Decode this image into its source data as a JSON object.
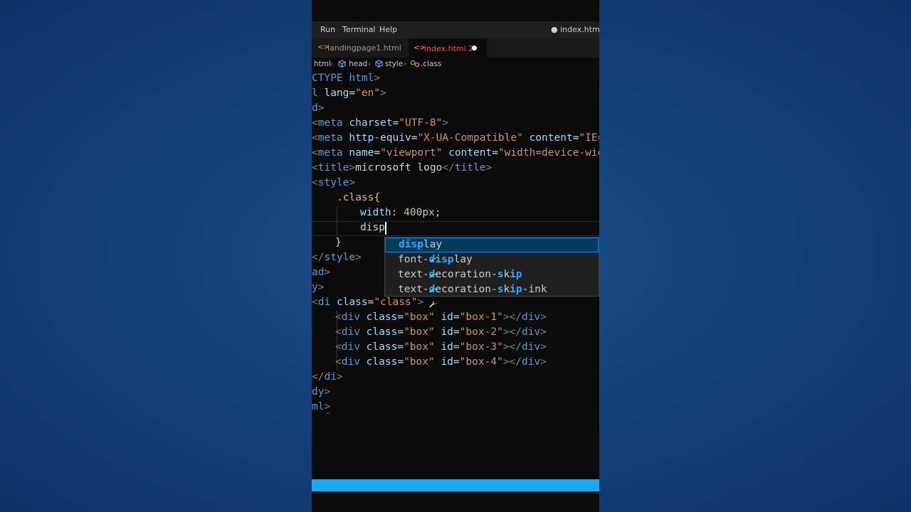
{
  "menu": {
    "run": "Run",
    "terminal": "Terminal",
    "help": "Help",
    "window_title": "● index.html - in"
  },
  "tabs": [
    {
      "icon": "<>",
      "label": "landingpage1.html"
    },
    {
      "icon": "<>",
      "label": "index.html 2"
    }
  ],
  "breadcrumb": {
    "html": "html",
    "head": "head",
    "style": "style",
    "class": ".class",
    "sep": "›"
  },
  "code": {
    "l1": {
      "t": "CTYPE html",
      "p": ">"
    },
    "l2": {
      "t": "l",
      "a": "lang",
      "eq": "=",
      "s": "\"en\"",
      "p": ">"
    },
    "l3": {
      "t": "d",
      "p": ">"
    },
    "l4": {
      "p1": "<",
      "t": "meta",
      "a": "charset",
      "eq": "=",
      "s": "\"UTF-8\"",
      "p2": ">"
    },
    "l5": {
      "p1": "<",
      "t": "meta",
      "a1": "http-equiv",
      "eq1": "=",
      "s1": "\"X-UA-Compatible\"",
      "a2": "content",
      "eq2": "=",
      "s2": "\"IE="
    },
    "l6": {
      "p1": "<",
      "t": "meta",
      "a1": "name",
      "eq1": "=",
      "s1": "\"viewport\"",
      "a2": "content",
      "eq2": "=",
      "s2": "\"width=device-wid"
    },
    "l7": {
      "p1": "<",
      "t1": "title",
      "p2": ">",
      "txt": "microsoft logo",
      "p3": "</",
      "t2": "title",
      "p4": ">"
    },
    "l8": {
      "p1": "<",
      "t": "style",
      "p2": ">"
    },
    "l9": {
      "sel": ".class",
      "br": "{"
    },
    "l10": {
      "prop": "width",
      "colon": ": ",
      "num": "400px",
      "semi": ";"
    },
    "l11": {
      "txt": "disp"
    },
    "l12": {
      "br": "}"
    },
    "l13": {
      "p1": "</",
      "t": "style",
      "p2": ">"
    },
    "l14": {
      "t": "ad",
      "p": ">"
    },
    "l15": {
      "t": "y",
      "p": ">"
    },
    "l16": {
      "p1": "<",
      "t": "di",
      "a": "class",
      "eq": "=",
      "s": "\"class\"",
      "p2": ">"
    },
    "boxes": [
      {
        "s1": "\"box\"",
        "s2": "\"box-1\""
      },
      {
        "s1": "\"box\"",
        "s2": "\"box-2\""
      },
      {
        "s1": "\"box\"",
        "s2": "\"box-3\""
      },
      {
        "s1": "\"box\"",
        "s2": "\"box-4\""
      }
    ],
    "box_tag": "div",
    "box_a1": "class",
    "box_a2": "id",
    "box_eq": "=",
    "box_open": "<",
    "box_gt": ">",
    "box_close": "</",
    "l21": {
      "p1": "</",
      "t": "di",
      "p2": ">"
    },
    "l22": {
      "t": "dy",
      "p": ">"
    },
    "l23": {
      "t": "ml",
      "p": ">"
    },
    "squiggle": "~"
  },
  "suggestions": [
    {
      "hl": "disp",
      "rest": "lay"
    },
    {
      "pre": "font-",
      "hl": "disp",
      "rest": "lay"
    },
    {
      "pre": "text-",
      "hl1": "d",
      "mid1": "ecoration-",
      "hl2": "s",
      "mid2": "k",
      "hl3": "ip",
      "rest": ""
    },
    {
      "pre": "text-",
      "hl1": "d",
      "mid1": "ecoration-",
      "hl2": "s",
      "mid2": "k",
      "hl3": "ip",
      "rest": "-ink"
    }
  ],
  "colors": {
    "accent": "#19a9f0",
    "tag": "#569cd6",
    "attr": "#9cdcfe",
    "string": "#ce9178",
    "highlight": "#2aaaff"
  }
}
